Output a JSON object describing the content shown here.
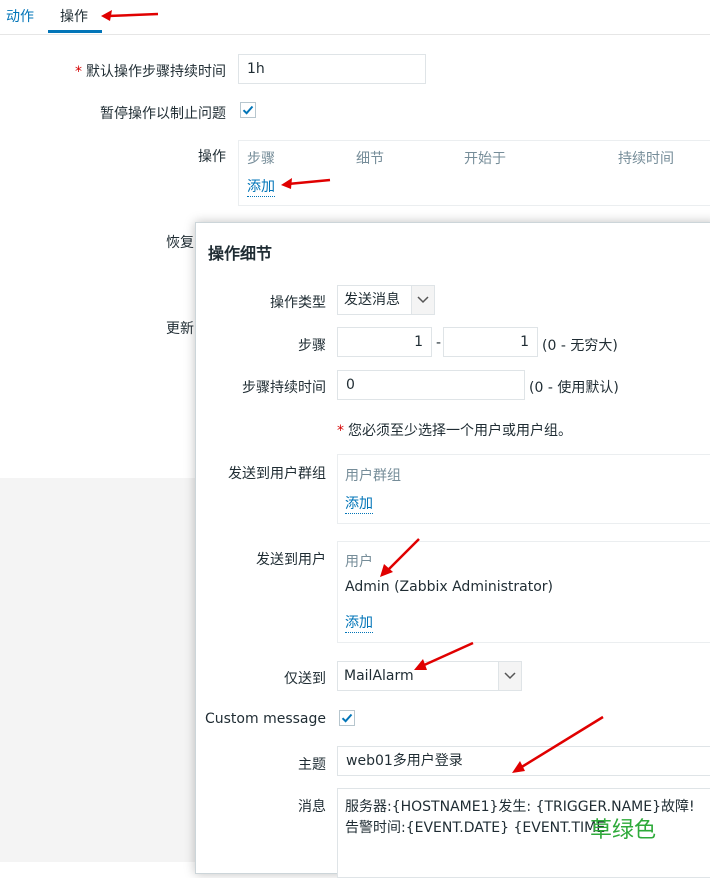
{
  "tabs": [
    {
      "label": "动作",
      "active": false
    },
    {
      "label": "操作",
      "active": true
    }
  ],
  "form": {
    "default_duration_label": "默认操作步骤持续时间",
    "default_duration_value": "1h",
    "pause_label": "暂停操作以制止问题",
    "pause_checked": true,
    "operations_label": "操作",
    "operations_columns": [
      "步骤",
      "细节",
      "开始于",
      "持续时间"
    ],
    "add_link": "添加",
    "recovery_label_partial": "恢复",
    "update_label_partial": "更新"
  },
  "modal": {
    "title": "操作细节",
    "operation_type_label": "操作类型",
    "operation_type_value": "发送消息",
    "steps_label": "步骤",
    "step_from": "1",
    "step_separator": "-",
    "step_to": "1",
    "steps_hint": "(0 - 无穷大)",
    "step_duration_label": "步骤持续时间",
    "step_duration_value": "0",
    "step_duration_hint": "(0 - 使用默认)",
    "warning": "您必须至少选择一个用户或用户组。",
    "send_groups_label": "发送到用户群组",
    "groups_header": "用户群组",
    "groups_add": "添加",
    "send_users_label": "发送到用户",
    "users_header": "用户",
    "users_list": [
      "Admin (Zabbix Administrator)"
    ],
    "users_add": "添加",
    "send_only_label": "仅送到",
    "send_only_value": "MailAlarm",
    "custom_message_label": "Custom message",
    "custom_message_checked": true,
    "subject_label": "主题",
    "subject_value": "web01多用户登录",
    "message_label": "消息",
    "message_line1": "服务器:{HOSTNAME1}发生: {TRIGGER.NAME}故障!",
    "message_line2": "告警时间:{EVENT.DATE} {EVENT.TIME"
  },
  "watermark": "草绿色",
  "colors": {
    "link": "#0275b8",
    "text": "#1f2c33",
    "muted": "#768d99",
    "annotation_arrow": "#e00000",
    "watermark": "#2eaa3a"
  }
}
